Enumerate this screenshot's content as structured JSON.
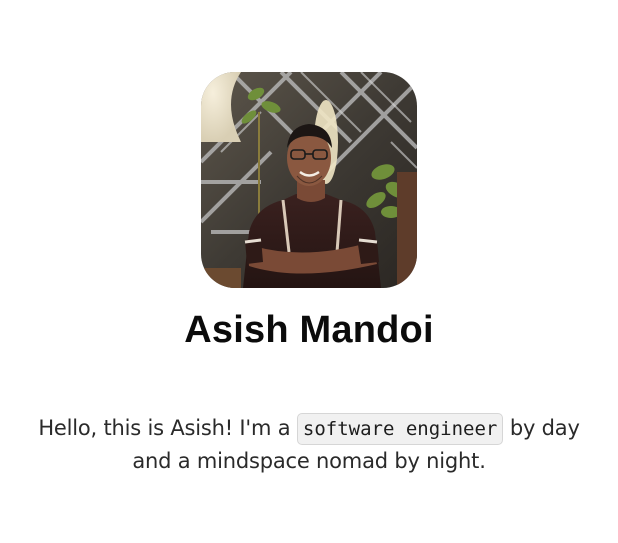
{
  "profile": {
    "avatar_icon": "profile-photo",
    "name": "Asish Mandoi",
    "bio": {
      "before": "Hello, this is Asish! I'm a ",
      "highlight": "software engineer",
      "after": " by day and a mindspace nomad by night."
    }
  },
  "colors": {
    "background": "#ffffff",
    "heading": "#0b0b0b",
    "body_text": "#2a2a2a",
    "code_background": "#f1f1f1",
    "code_border": "#d6d6d6"
  }
}
